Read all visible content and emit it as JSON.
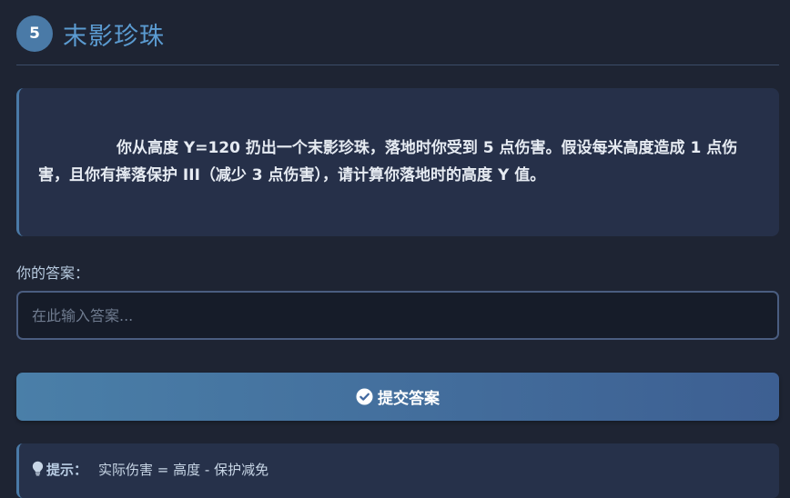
{
  "question": {
    "number": "5",
    "title": "末影珍珠",
    "text": "你从高度 Y=120 扔出一个末影珍珠，落地时你受到 5 点伤害。假设每米高度造成 1 点伤害，且你有摔落保护 III（减少 3 点伤害），请计算你落地时的高度 Y 值。"
  },
  "answer": {
    "label": "你的答案：",
    "value": "",
    "placeholder": "在此输入答案..."
  },
  "submit": {
    "label": "提交答案",
    "icon": "check-circle-icon"
  },
  "hint": {
    "icon": "lightbulb-icon",
    "label": "提示：",
    "text": "实际伤害 = 高度 - 保护减免"
  },
  "colors": {
    "background": "#1e2433",
    "accent": "#4a7aa7",
    "title": "#5b9bd1",
    "card": "#263049"
  }
}
